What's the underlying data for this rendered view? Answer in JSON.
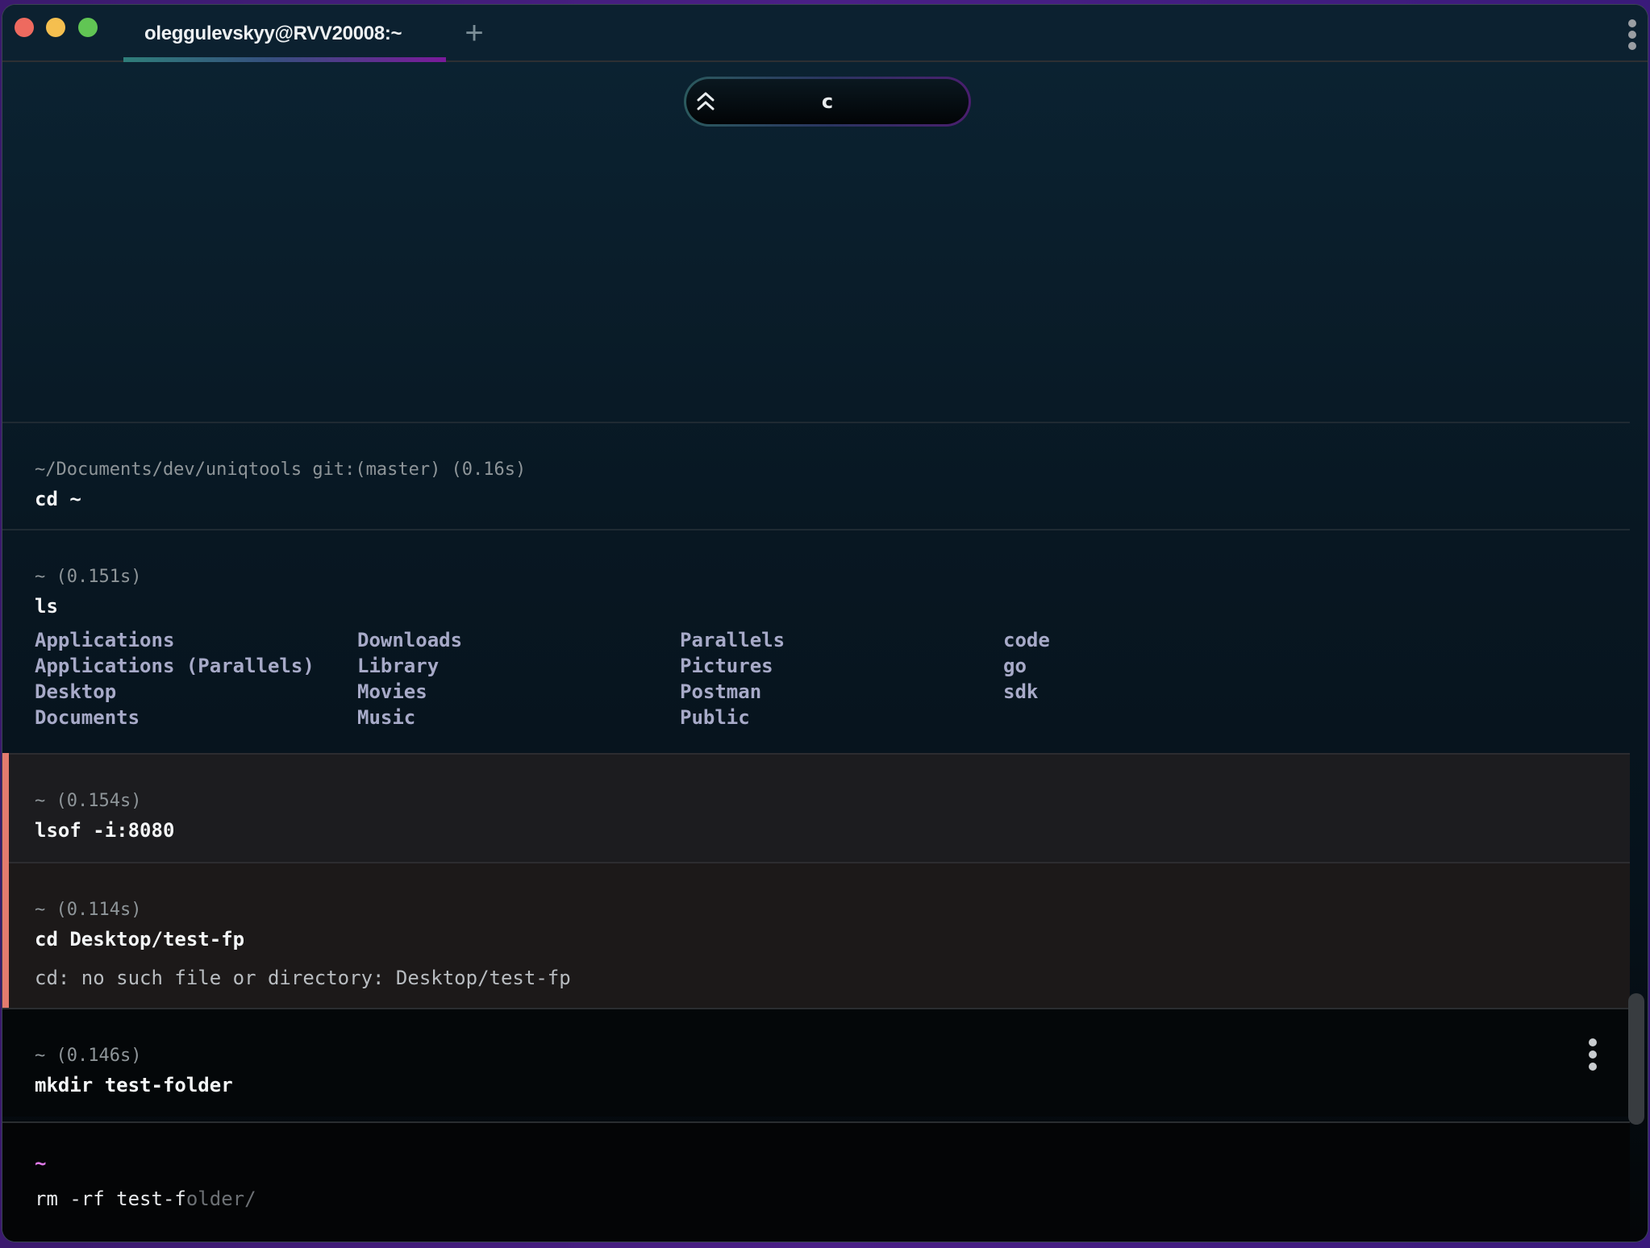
{
  "window": {
    "tab_title": "oleggulevskyy@RVV20008:~",
    "new_tab_label": "+",
    "colors": {
      "accent_gradient": [
        "#2f7e7a",
        "#35507e",
        "#7a1a9a"
      ],
      "error_bar": "#e37b6e",
      "prompt": "#e07ae8",
      "ls_item": "#a7aac8"
    }
  },
  "pill": {
    "icon": "double-chevron-up-icon",
    "text": "c"
  },
  "blocks": [
    {
      "header": "~/Documents/dev/uniqtools git:(master) (0.16s)",
      "command": "cd ~",
      "status": "success"
    },
    {
      "header": "~ (0.151s)",
      "command": "ls",
      "status": "success",
      "output_columns": [
        [
          "Applications",
          "Applications (Parallels)",
          "Desktop",
          "Documents"
        ],
        [
          "Downloads",
          "Library",
          "Movies",
          "Music"
        ],
        [
          "Parallels",
          "Pictures",
          "Postman",
          "Public"
        ],
        [
          "code",
          "go",
          "sdk"
        ]
      ]
    },
    {
      "header": "~ (0.154s)",
      "command": "lsof -i:8080",
      "status": "error"
    },
    {
      "header": "~ (0.114s)",
      "command": "cd Desktop/test-fp",
      "status": "error",
      "output": "cd: no such file or directory: Desktop/test-fp"
    },
    {
      "header": "~ (0.146s)",
      "command": "mkdir test-folder",
      "status": "success"
    }
  ],
  "input": {
    "prompt": "~",
    "typed": "rm -rf test-f",
    "suggestion": "older/"
  }
}
